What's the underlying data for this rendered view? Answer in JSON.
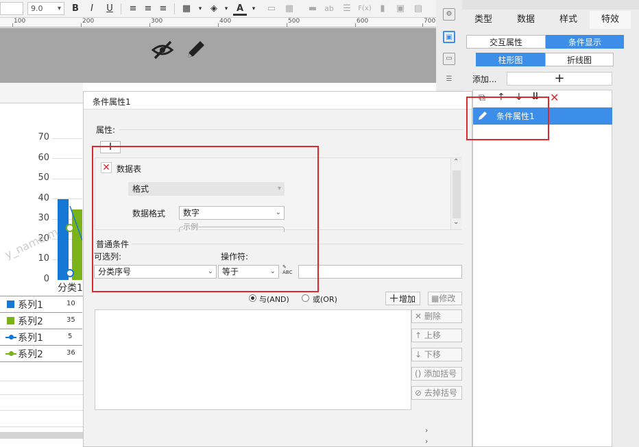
{
  "toolbar": {
    "font_size_value": "9.0",
    "bold": "B",
    "italic": "I",
    "underline": "U",
    "font_color_label": "A",
    "text_abc": "ab",
    "fx_label": "F(x)"
  },
  "ruler": {
    "marks": [
      "100",
      "200",
      "300",
      "400",
      "500",
      "600",
      "700"
    ]
  },
  "right_panel": {
    "tabs": [
      "类型",
      "数据",
      "样式",
      "特效"
    ],
    "mode_tabs": {
      "interaction": "交互属性",
      "condition": "条件显示"
    },
    "chart_tabs": {
      "bar": "柱形图",
      "line": "折线图"
    },
    "add_label": "添加...",
    "add_plus": "+",
    "list_items": [
      "条件属性1"
    ],
    "delete_glyph": "✕"
  },
  "chart": {
    "yticks": [
      "70",
      "60",
      "50",
      "40",
      "30",
      "20",
      "10",
      "0"
    ],
    "category": "分类1",
    "watermark": "y_name,m"
  },
  "chart_data": {
    "type": "bar",
    "categories": [
      "分类1"
    ],
    "series": [
      {
        "name": "系列1",
        "values": [
          40
        ]
      },
      {
        "name": "系列2",
        "values": [
          35
        ]
      }
    ],
    "ylim": [
      0,
      70
    ]
  },
  "legend_table": [
    {
      "name": "系列1",
      "value": "10",
      "color": "#1478d4",
      "kind": "bar"
    },
    {
      "name": "系列2",
      "value": "35",
      "color": "#7ab317",
      "kind": "bar"
    },
    {
      "name": "系列1",
      "value": "5",
      "color": "#1478d4",
      "kind": "line"
    },
    {
      "name": "系列2",
      "value": "36",
      "color": "#7ab317",
      "kind": "line"
    }
  ],
  "dialog": {
    "title": "条件属性1",
    "attr_group": "属性:",
    "attr_add": "+",
    "attr_item": "数据表",
    "format_label": "格式",
    "data_format_label": "数据格式",
    "data_format_value": "数字",
    "example_label": "示例",
    "cond_group": "普通条件",
    "optional_col_label": "可选列:",
    "optional_col_value": "分类序号",
    "operator_label": "操作符:",
    "operator_value": "等于",
    "abc_label": "ABC",
    "and_label": "与(AND)",
    "or_label": "或(OR)",
    "add_btn": "增加",
    "edit_btn": "修改",
    "delete_btn": "删除",
    "up_btn": "上移",
    "down_btn": "下移",
    "add_bracket_btn": "添加括号",
    "remove_bracket_btn": "去掉括号"
  }
}
